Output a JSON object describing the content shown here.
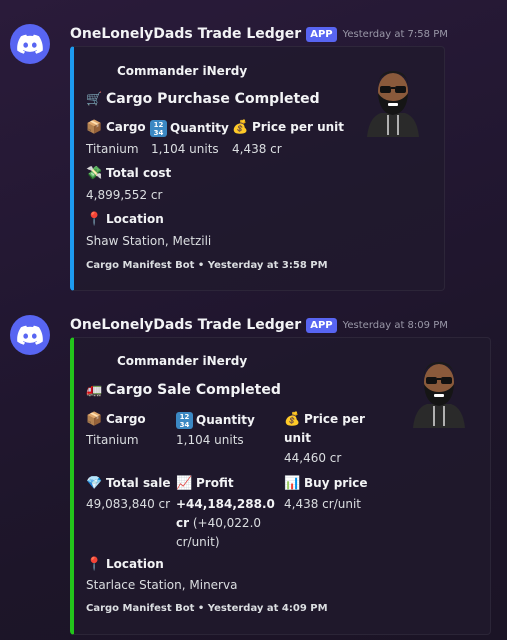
{
  "accent_purchase": "#1d9bf0",
  "accent_sale": "#23c51b",
  "messages": [
    {
      "username": "OneLonelyDads Trade Ledger",
      "badge": "APP",
      "timestamp": "Yesterday at 7:58 PM",
      "embed": {
        "author": "Commander iNerdy",
        "title_icon": "shopping-cart-icon",
        "title": "Cargo Purchase Completed",
        "fields": [
          {
            "name": "Cargo",
            "value": "Titanium",
            "icon": "package-icon"
          },
          {
            "name": "Quantity",
            "value": "1,104 units",
            "icon": "numbers-1234-icon"
          },
          {
            "name": "Price per unit",
            "value": "4,438 cr",
            "icon": "money-bag-icon"
          },
          {
            "name": "Total cost",
            "value": "4,899,552 cr",
            "icon": "money-flying-icon"
          },
          {
            "name": "Location",
            "value": "Shaw Station, Metzili",
            "icon": "pin-icon"
          }
        ],
        "footer": "Cargo Manifest Bot • Yesterday at 3:58 PM"
      }
    },
    {
      "username": "OneLonelyDads Trade Ledger",
      "badge": "APP",
      "timestamp": "Yesterday at 8:09 PM",
      "embed": {
        "author": "Commander iNerdy",
        "title_icon": "delivery-truck-icon",
        "title": "Cargo Sale Completed",
        "fields": [
          {
            "name": "Cargo",
            "value": "Titanium",
            "icon": "package-icon"
          },
          {
            "name": "Quantity",
            "value": "1,104 units",
            "icon": "numbers-1234-icon"
          },
          {
            "name_line1": "Price per",
            "name_line2": "unit",
            "value": "44,460 cr",
            "icon": "money-bag-icon"
          },
          {
            "name": "Total sale",
            "value": "49,083,840 cr",
            "icon": "gem-icon"
          },
          {
            "name": "Profit",
            "value_bold": "+44,184,288.0",
            "value_bold2": "cr",
            "value_rest": " (+40,022.0",
            "value_line3": "cr/unit)",
            "icon": "chart-up-icon"
          },
          {
            "name": "Buy price",
            "value": "4,438 cr/unit",
            "icon": "bar-chart-icon"
          },
          {
            "name": "Location",
            "value": "Starlace Station, Minerva",
            "icon": "pin-icon"
          }
        ],
        "footer": "Cargo Manifest Bot • Yesterday at 4:09 PM"
      }
    }
  ]
}
